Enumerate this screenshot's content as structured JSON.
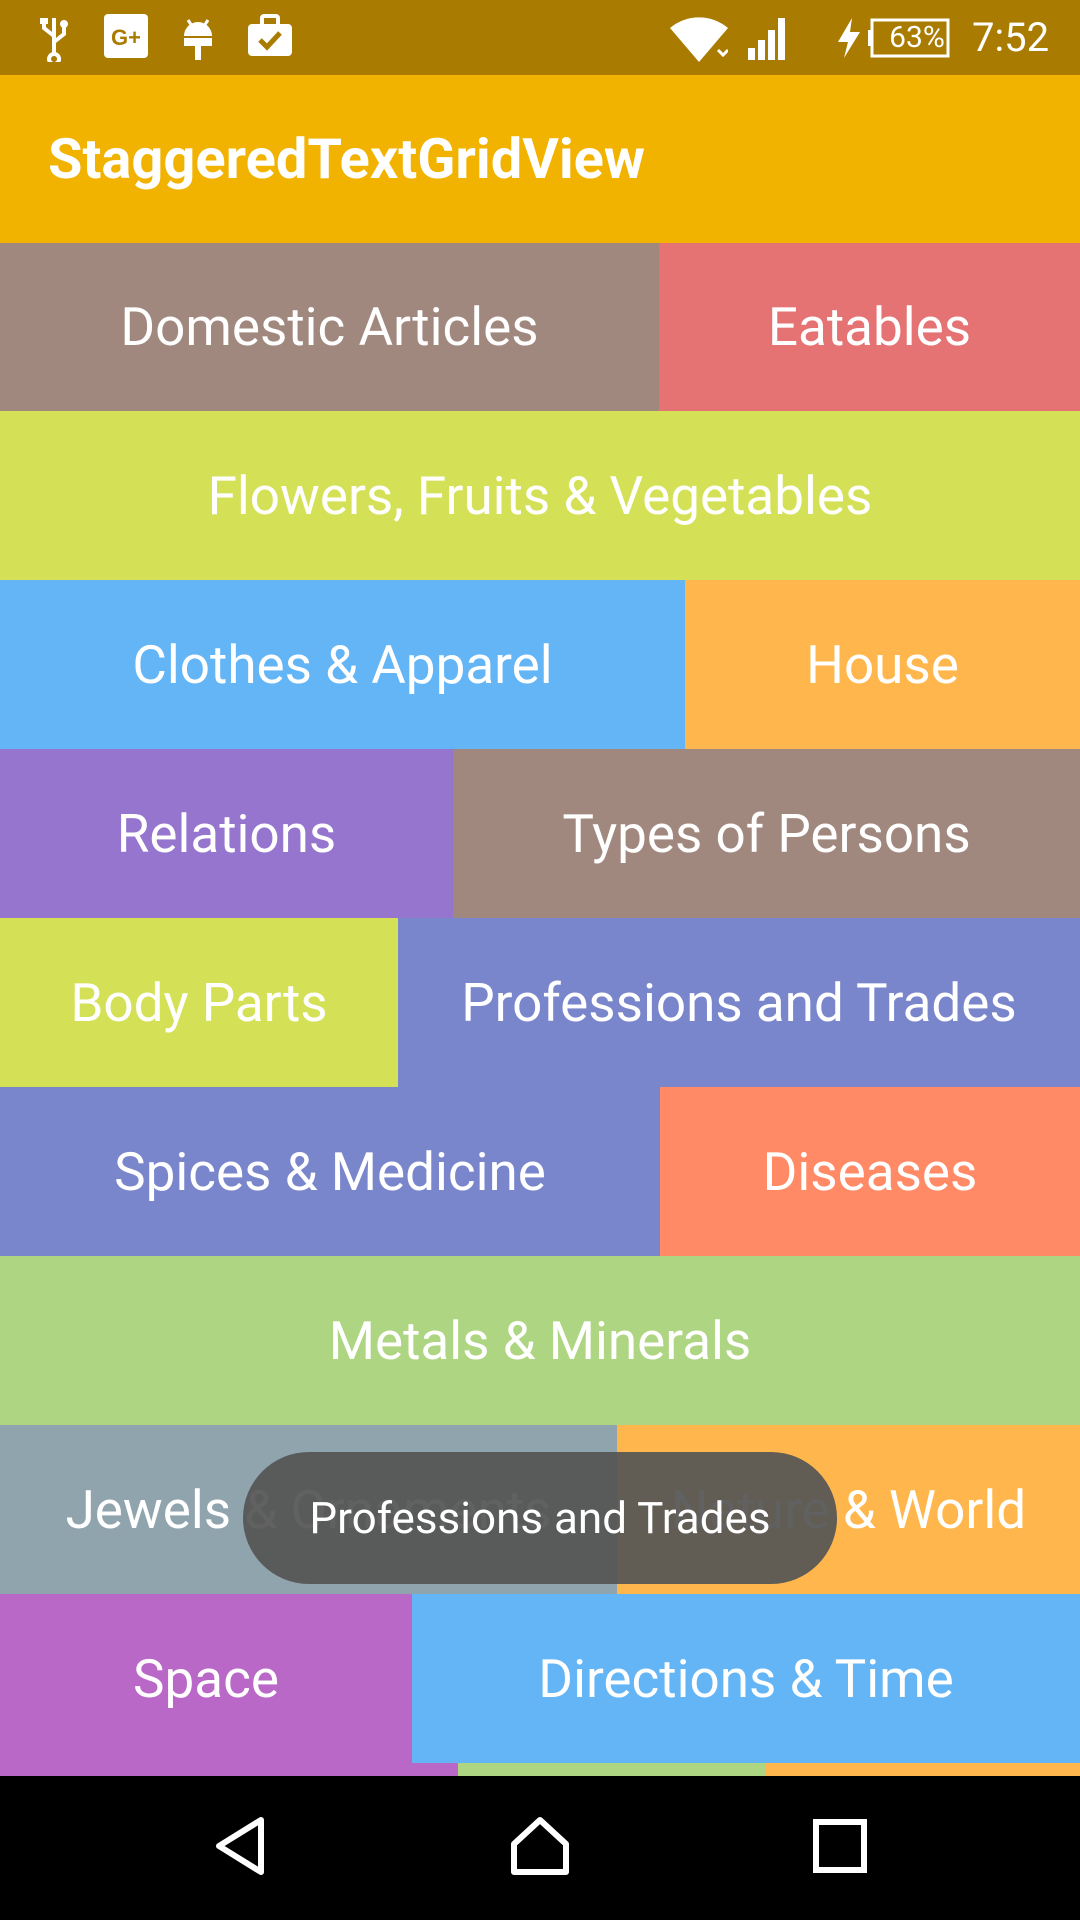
{
  "status_bar": {
    "battery": "63%",
    "time": "7:52",
    "icons": [
      "usb-icon",
      "google-plus-icon",
      "android-debug-icon",
      "work-briefcase-icon",
      "wifi-icon",
      "cell-signal-icon",
      "charging-bolt-icon",
      "battery-icon"
    ]
  },
  "app_bar": {
    "title": "StaggeredTextGridView"
  },
  "colors": {
    "status_bar": "#A97B00",
    "app_bar": "#F2B200",
    "brown": "#A1887F",
    "red": "#E57373",
    "lime": "#D4E157",
    "blue": "#64B5F6",
    "orange": "#FFB74D",
    "purple": "#9575CD",
    "indigo": "#7986CB",
    "deep_orange": "#FF8A65",
    "light_green": "#AED581",
    "blue_grey": "#90A4AE",
    "magenta": "#BA68C8"
  },
  "grid": {
    "items": [
      {
        "label": "Domestic Articles"
      },
      {
        "label": "Eatables"
      },
      {
        "label": "Flowers, Fruits & Vegetables"
      },
      {
        "label": "Clothes & Apparel"
      },
      {
        "label": "House"
      },
      {
        "label": "Relations"
      },
      {
        "label": "Types of Persons"
      },
      {
        "label": "Body Parts"
      },
      {
        "label": "Professions and Trades"
      },
      {
        "label": "Spices & Medicine"
      },
      {
        "label": "Diseases"
      },
      {
        "label": "Metals & Minerals"
      },
      {
        "label": "Jewels & Ornaments"
      },
      {
        "label": "Nature & World"
      },
      {
        "label": "Space"
      },
      {
        "label": "Directions & Time"
      }
    ]
  },
  "toast": {
    "text": "Professions and Trades"
  },
  "nav_bar": {
    "icons": [
      "back-icon",
      "home-icon",
      "recents-icon"
    ]
  }
}
